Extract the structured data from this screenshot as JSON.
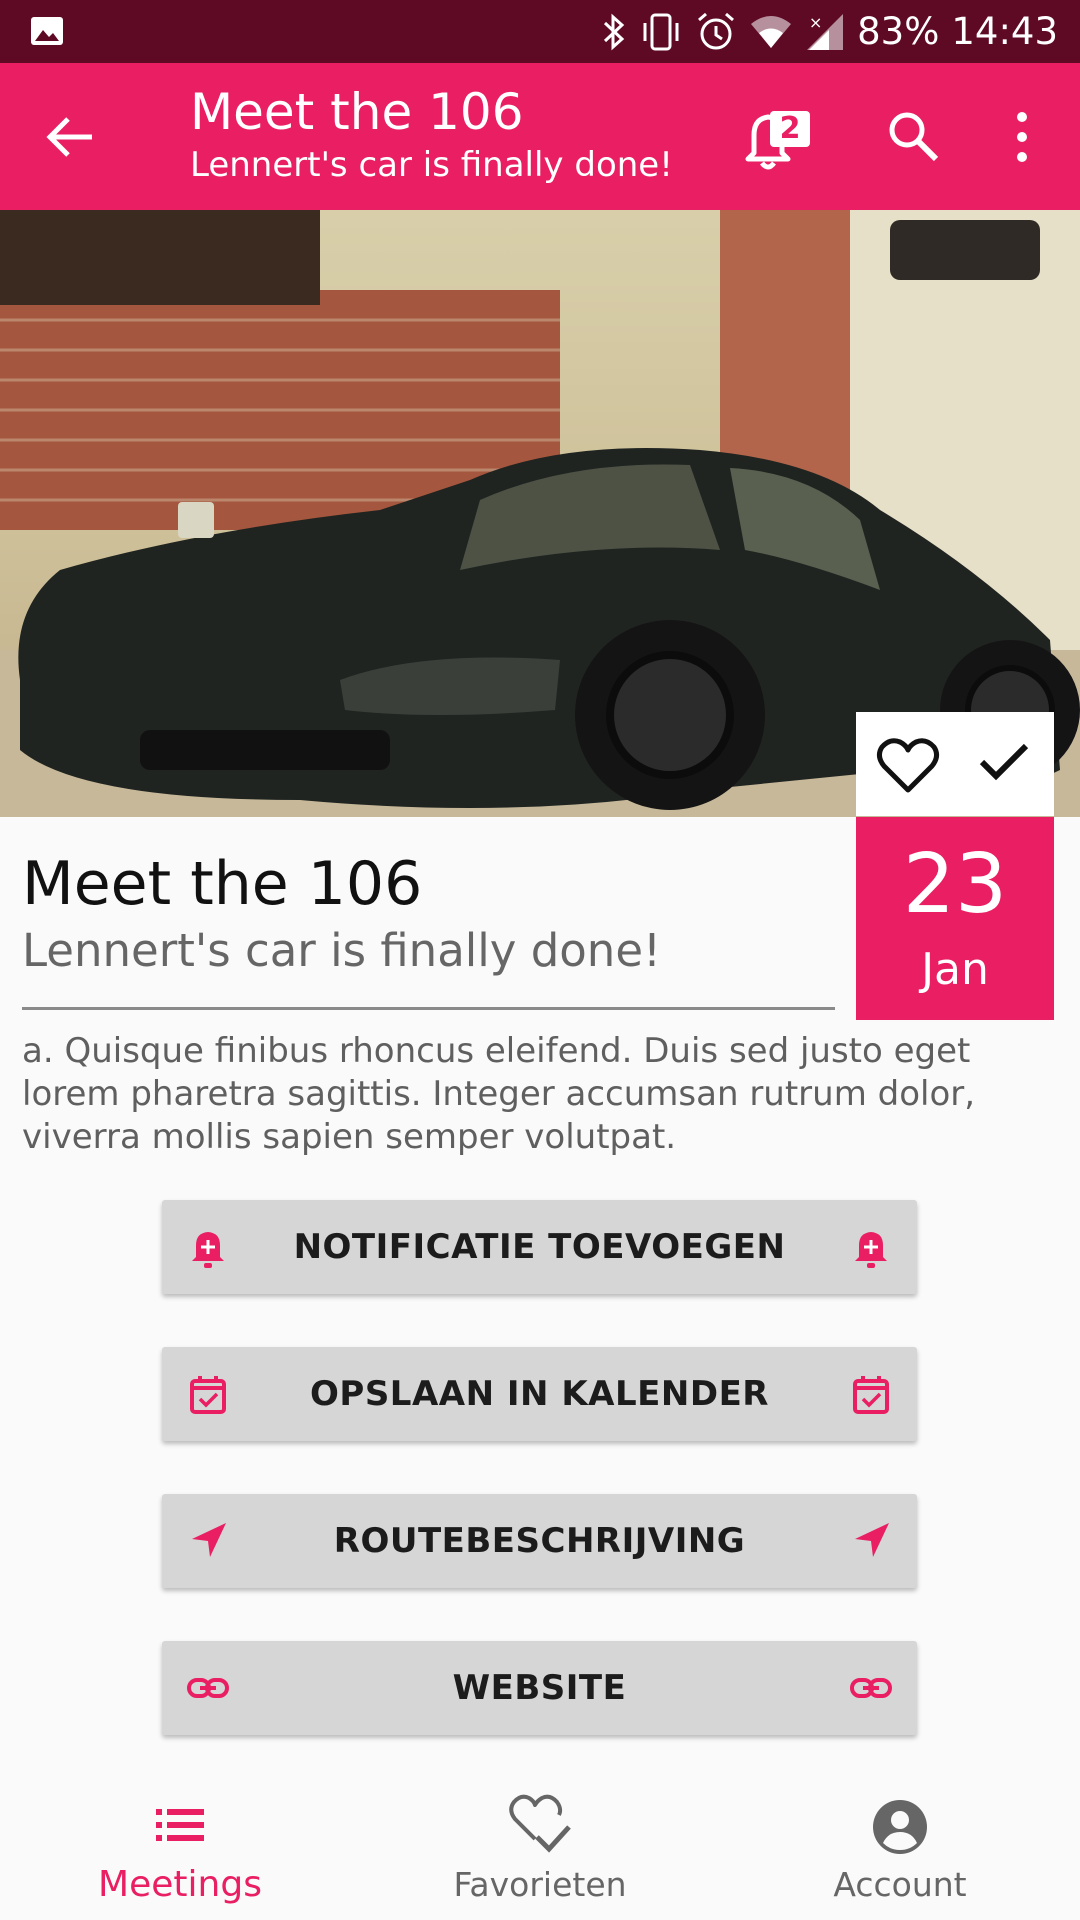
{
  "status_bar": {
    "battery": "83%",
    "time": "14:43",
    "icons": [
      "image-icon",
      "bluetooth-icon",
      "vibrate-icon",
      "alarm-icon",
      "wifi-icon",
      "signal-icon"
    ]
  },
  "app_bar": {
    "title": "Meet the 106",
    "subtitle": "Lennert's car is finally done!",
    "notification_count": "2",
    "icons": [
      "back-arrow-icon",
      "bell-icon",
      "search-icon",
      "more-vert-icon"
    ]
  },
  "event": {
    "title": "Meet the 106",
    "subtitle": "Lennert's car is finally done!",
    "date_day": "23",
    "date_month": "Jan",
    "description": "a. Quisque finibus rhoncus eleifend. Duis sed justo eget lorem pharetra sagittis. Integer accumsan rutrum dolor, viverra mollis sapien semper volutpat."
  },
  "actions": [
    {
      "label": "NOTIFICATIE TOEVOEGEN",
      "icon": "bell-plus-icon"
    },
    {
      "label": "OPSLAAN IN KALENDER",
      "icon": "calendar-check-icon"
    },
    {
      "label": "ROUTEBESCHRIJVING",
      "icon": "navigation-icon"
    },
    {
      "label": "WEBSITE",
      "icon": "link-icon"
    }
  ],
  "bottom_nav": [
    {
      "label": "Meetings",
      "icon": "list-icon",
      "active": true
    },
    {
      "label": "Favorieten",
      "icon": "heart-check-icon",
      "active": false
    },
    {
      "label": "Account",
      "icon": "account-circle-icon",
      "active": false
    }
  ],
  "colors": {
    "accent": "#e91e63",
    "status_bar": "#5e0a25",
    "button_bg": "#d6d6d6",
    "inactive_nav": "#666666"
  }
}
